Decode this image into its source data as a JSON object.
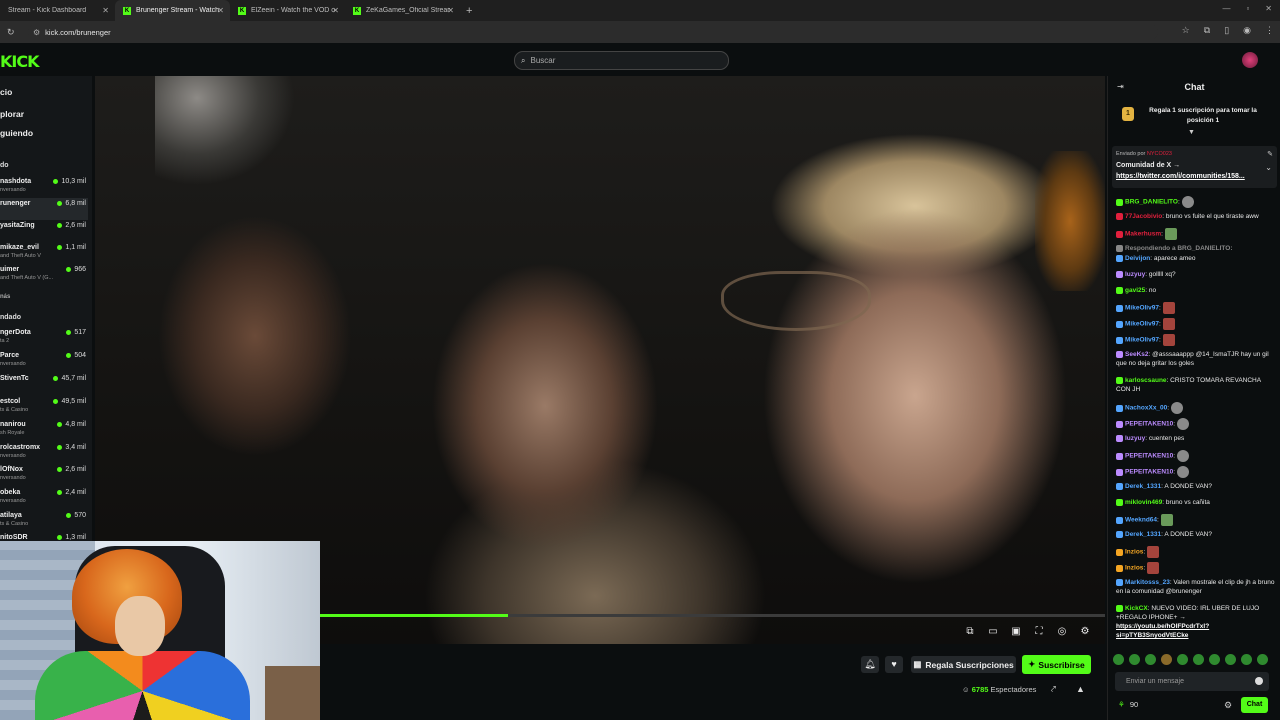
{
  "tabs": [
    {
      "title": "Stream - Kick Dashboard"
    },
    {
      "title": "Brunenger Stream - Watch Live"
    },
    {
      "title": "ElZeein - Watch the VOD on Kick"
    },
    {
      "title": "ZeKaGames_Oficial Stream - Watch"
    }
  ],
  "url": "kick.com/brunenger",
  "logo": "KICK",
  "search": {
    "placeholder": "Buscar"
  },
  "sidebar": {
    "nav": [
      "cio",
      "plorar",
      "guiendo"
    ],
    "section_following": "do",
    "following": [
      {
        "name": "nashdota",
        "sub": "nversando",
        "viewers": "10,3 mil"
      },
      {
        "name": "runenger",
        "sub": "",
        "viewers": "6,8 mil"
      },
      {
        "name": "yasitaZing",
        "sub": "",
        "viewers": "2,6 mil"
      },
      {
        "name": "mikaze_evil",
        "sub": "and Theft Auto V",
        "viewers": "1,1 mil"
      },
      {
        "name": "uimer",
        "sub": "and Theft Auto V (G...",
        "viewers": "966"
      }
    ],
    "more_following": "nás",
    "section_recommended": "ndado",
    "recommended": [
      {
        "name": "ngerDota",
        "sub": "ta 2",
        "viewers": "517"
      },
      {
        "name": "Parce",
        "sub": "nversando",
        "viewers": "504"
      },
      {
        "name": "StivenTc",
        "sub": "",
        "viewers": "45,7 mil"
      },
      {
        "name": "estcol",
        "sub": "ts & Casino",
        "viewers": "49,5 mil"
      },
      {
        "name": "nanirou",
        "sub": "sh Royale",
        "viewers": "4,8 mil"
      },
      {
        "name": "rolcastromx",
        "sub": "nversando",
        "viewers": "3,4 mil"
      },
      {
        "name": "lOfNox",
        "sub": "nversando",
        "viewers": "2,6 mil"
      },
      {
        "name": "obeka",
        "sub": "nversando",
        "viewers": "2,4 mil"
      },
      {
        "name": "atilaya",
        "sub": "ts & Casino",
        "viewers": "570"
      },
      {
        "name": "nitoSDR",
        "sub": "",
        "viewers": "1,3 mil"
      }
    ]
  },
  "player": {
    "progress": 0.24
  },
  "actions": {
    "gift_label": "Regala Suscripciones",
    "subscribe_label": "Suscribirse"
  },
  "stream": {
    "viewers": "6785",
    "viewers_label": "Espectadores"
  },
  "chat": {
    "title": "Chat",
    "gift_banner": {
      "rank": "1",
      "text": "Regala 1 suscripción para tomar la posición 1"
    },
    "pinned": {
      "sent_by": "Enviado por",
      "sender": "NYCO023",
      "line1": "Comunidad de X →",
      "line2": "https://twitter.com/i/communities/158..."
    },
    "messages": [
      {
        "user": "BRG_DANIELITO",
        "color": "#53fc18",
        "text": ":",
        "emote": "s"
      },
      {
        "user": "77Jacobivio",
        "color": "#e1203d",
        "text": ": bruno vs fuite el que tiraste aww"
      },
      {
        "user": "Makerhusm",
        "color": "#e1203d",
        "text": ":",
        "emote": "g"
      },
      {
        "user": "Respondiendo a BRG_DANIELITO:",
        "color": "#888",
        "text": ""
      },
      {
        "user": "Deivijon",
        "color": "#54a6ff",
        "text": ": aparece ameo"
      },
      {
        "user": "luzyuy",
        "color": "#bc8cff",
        "text": ": golllll xq?"
      },
      {
        "user": "gavi25",
        "color": "#53fc18",
        "text": ": no"
      },
      {
        "user": "MikeOliv97",
        "color": "#54a6ff",
        "text": ":",
        "emote": "r"
      },
      {
        "user": "MikeOliv97",
        "color": "#54a6ff",
        "text": ":",
        "emote": "r"
      },
      {
        "user": "MikeOliv97",
        "color": "#54a6ff",
        "text": ":",
        "emote": "r"
      },
      {
        "user": "SeeKs2",
        "color": "#bc8cff",
        "text": ": @asssaaappp @14_IsmaTJR hay un gil que no deja gritar los goles"
      },
      {
        "user": "karloscsaune",
        "color": "#53fc18",
        "text": ": CRISTO TOMARA REVANCHA CON JH"
      },
      {
        "user": "NachoxXx_00",
        "color": "#54a6ff",
        "text": ":",
        "emote": "y"
      },
      {
        "user": "PEPEITAKEN10",
        "color": "#bc8cff",
        "text": ":",
        "emote": "s"
      },
      {
        "user": "luzyuy",
        "color": "#bc8cff",
        "text": ": cuenten pes"
      },
      {
        "user": "PEPEITAKEN10",
        "color": "#bc8cff",
        "text": ":",
        "emote": "s"
      },
      {
        "user": "PEPEITAKEN10",
        "color": "#bc8cff",
        "text": ":",
        "emote": "s"
      },
      {
        "user": "Derek_1331",
        "color": "#54a6ff",
        "text": ": A DONDE VAN?"
      },
      {
        "user": "miklovin469",
        "color": "#53fc18",
        "text": ": bruno vs cañita"
      },
      {
        "user": "Weeknd64",
        "color": "#54a6ff",
        "text": ":",
        "emote": "g"
      },
      {
        "user": "Derek_1331",
        "color": "#54a6ff",
        "text": ": A DONDE VAN?"
      },
      {
        "user": "Inzios",
        "color": "#f5a623",
        "text": ":",
        "emote": "r"
      },
      {
        "user": "Inzios",
        "color": "#f5a623",
        "text": ":",
        "emote": "r"
      },
      {
        "user": "Markitosss_23",
        "color": "#54a6ff",
        "text": ": Valen mostrale el clip de jh a bruno en la comunidad @brunenger"
      },
      {
        "user": "KickCX",
        "color": "#53fc18",
        "text": ": NUEVO VIDEO: IRL UBER DE LUJO +REGALO IPHONE+ →",
        "link": "https://youtu.be/hOlFPcdrTxl?si=pTYB3SnyodVtECke"
      }
    ],
    "input_placeholder": "Enviar un mensaje",
    "points": "90",
    "chat_button": "Chat"
  }
}
